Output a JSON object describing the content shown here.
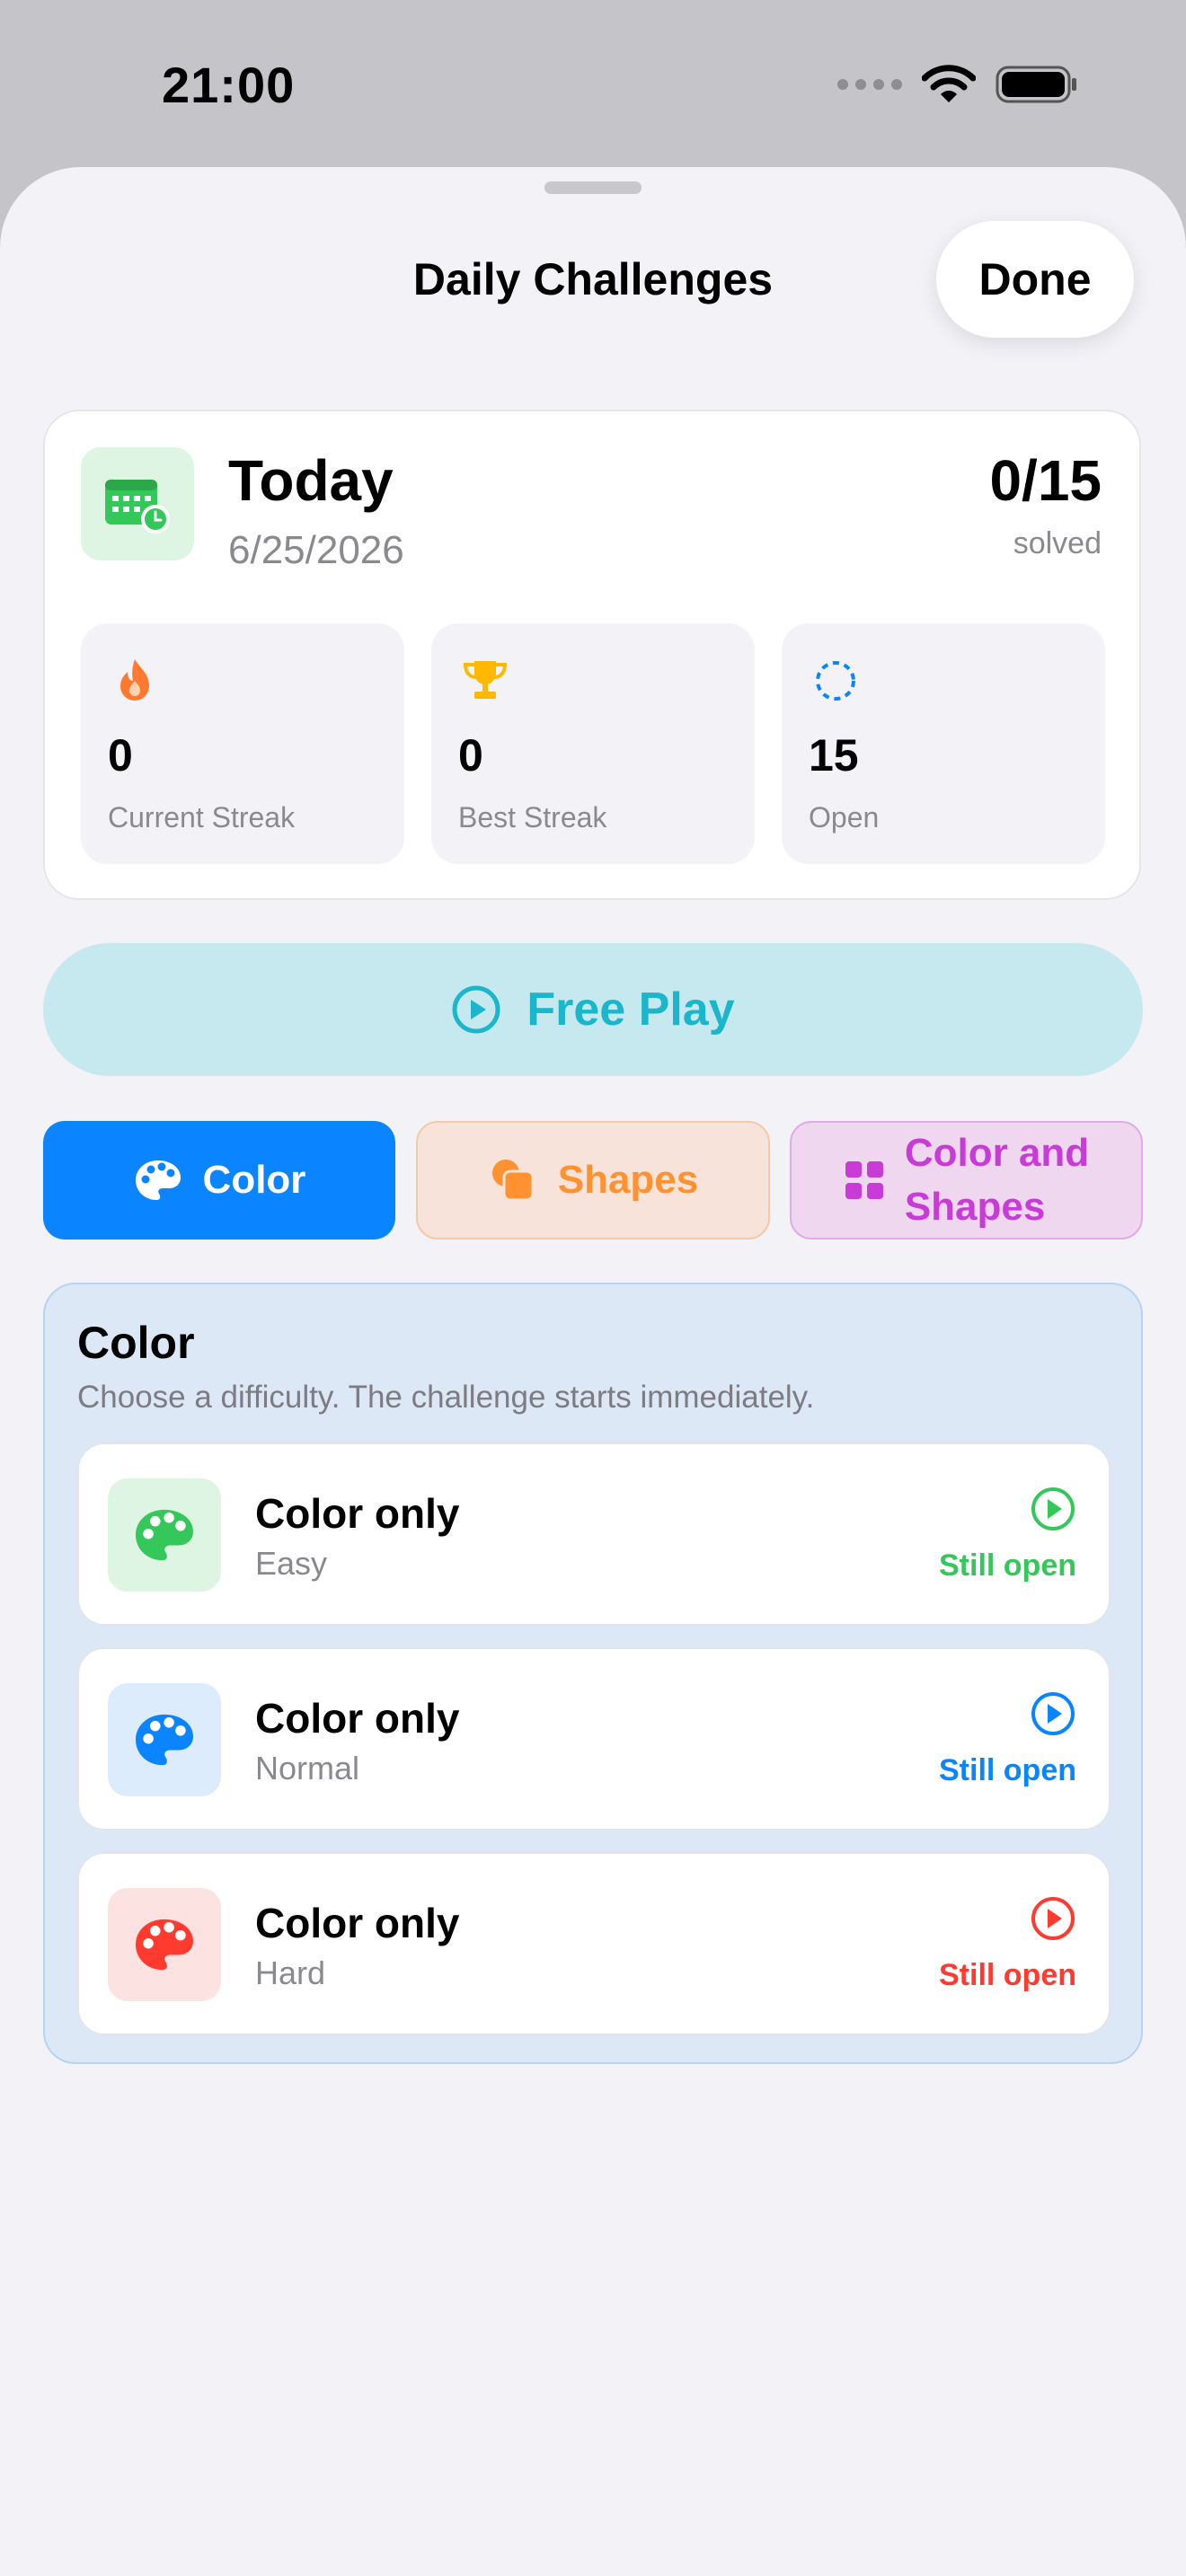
{
  "status_bar": {
    "time": "21:00"
  },
  "nav": {
    "title": "Daily Challenges",
    "done_label": "Done"
  },
  "today_card": {
    "title": "Today",
    "date": "6/25/2026",
    "progress_text": "0/15",
    "progress_label": "solved",
    "stats": [
      {
        "icon": "flame-icon",
        "value": "0",
        "label": "Current Streak",
        "color": "#ff7a30"
      },
      {
        "icon": "trophy-icon",
        "value": "0",
        "label": "Best Streak",
        "color": "#ffb800"
      },
      {
        "icon": "dashed-circle-icon",
        "value": "15",
        "label": "Open",
        "color": "#0a84ff"
      }
    ]
  },
  "free_play": {
    "label": "Free Play",
    "color": "#1cb6cc"
  },
  "mode_tabs": [
    {
      "label": "Color",
      "icon": "palette-icon",
      "selected": true
    },
    {
      "label": "Shapes",
      "icon": "shapes-icon",
      "selected": false
    },
    {
      "label_line1": "Color and",
      "label_line2": "Shapes",
      "icon": "grid-icon",
      "selected": false
    }
  ],
  "section": {
    "title": "Color",
    "subtitle": "Choose a difficulty. The challenge starts immediately.",
    "rows": [
      {
        "title": "Color only",
        "difficulty": "Easy",
        "status": "Still open",
        "color": "#34c759",
        "tile": "#dff5e3"
      },
      {
        "title": "Color only",
        "difficulty": "Normal",
        "status": "Still open",
        "color": "#0a84ff",
        "tile": "#dcecfd"
      },
      {
        "title": "Color only",
        "difficulty": "Hard",
        "status": "Still open",
        "color": "#ff3b30",
        "tile": "#fde2e2"
      }
    ]
  },
  "colors": {
    "accent": "#0a84ff",
    "sheet_bg": "#f2f2f7"
  }
}
